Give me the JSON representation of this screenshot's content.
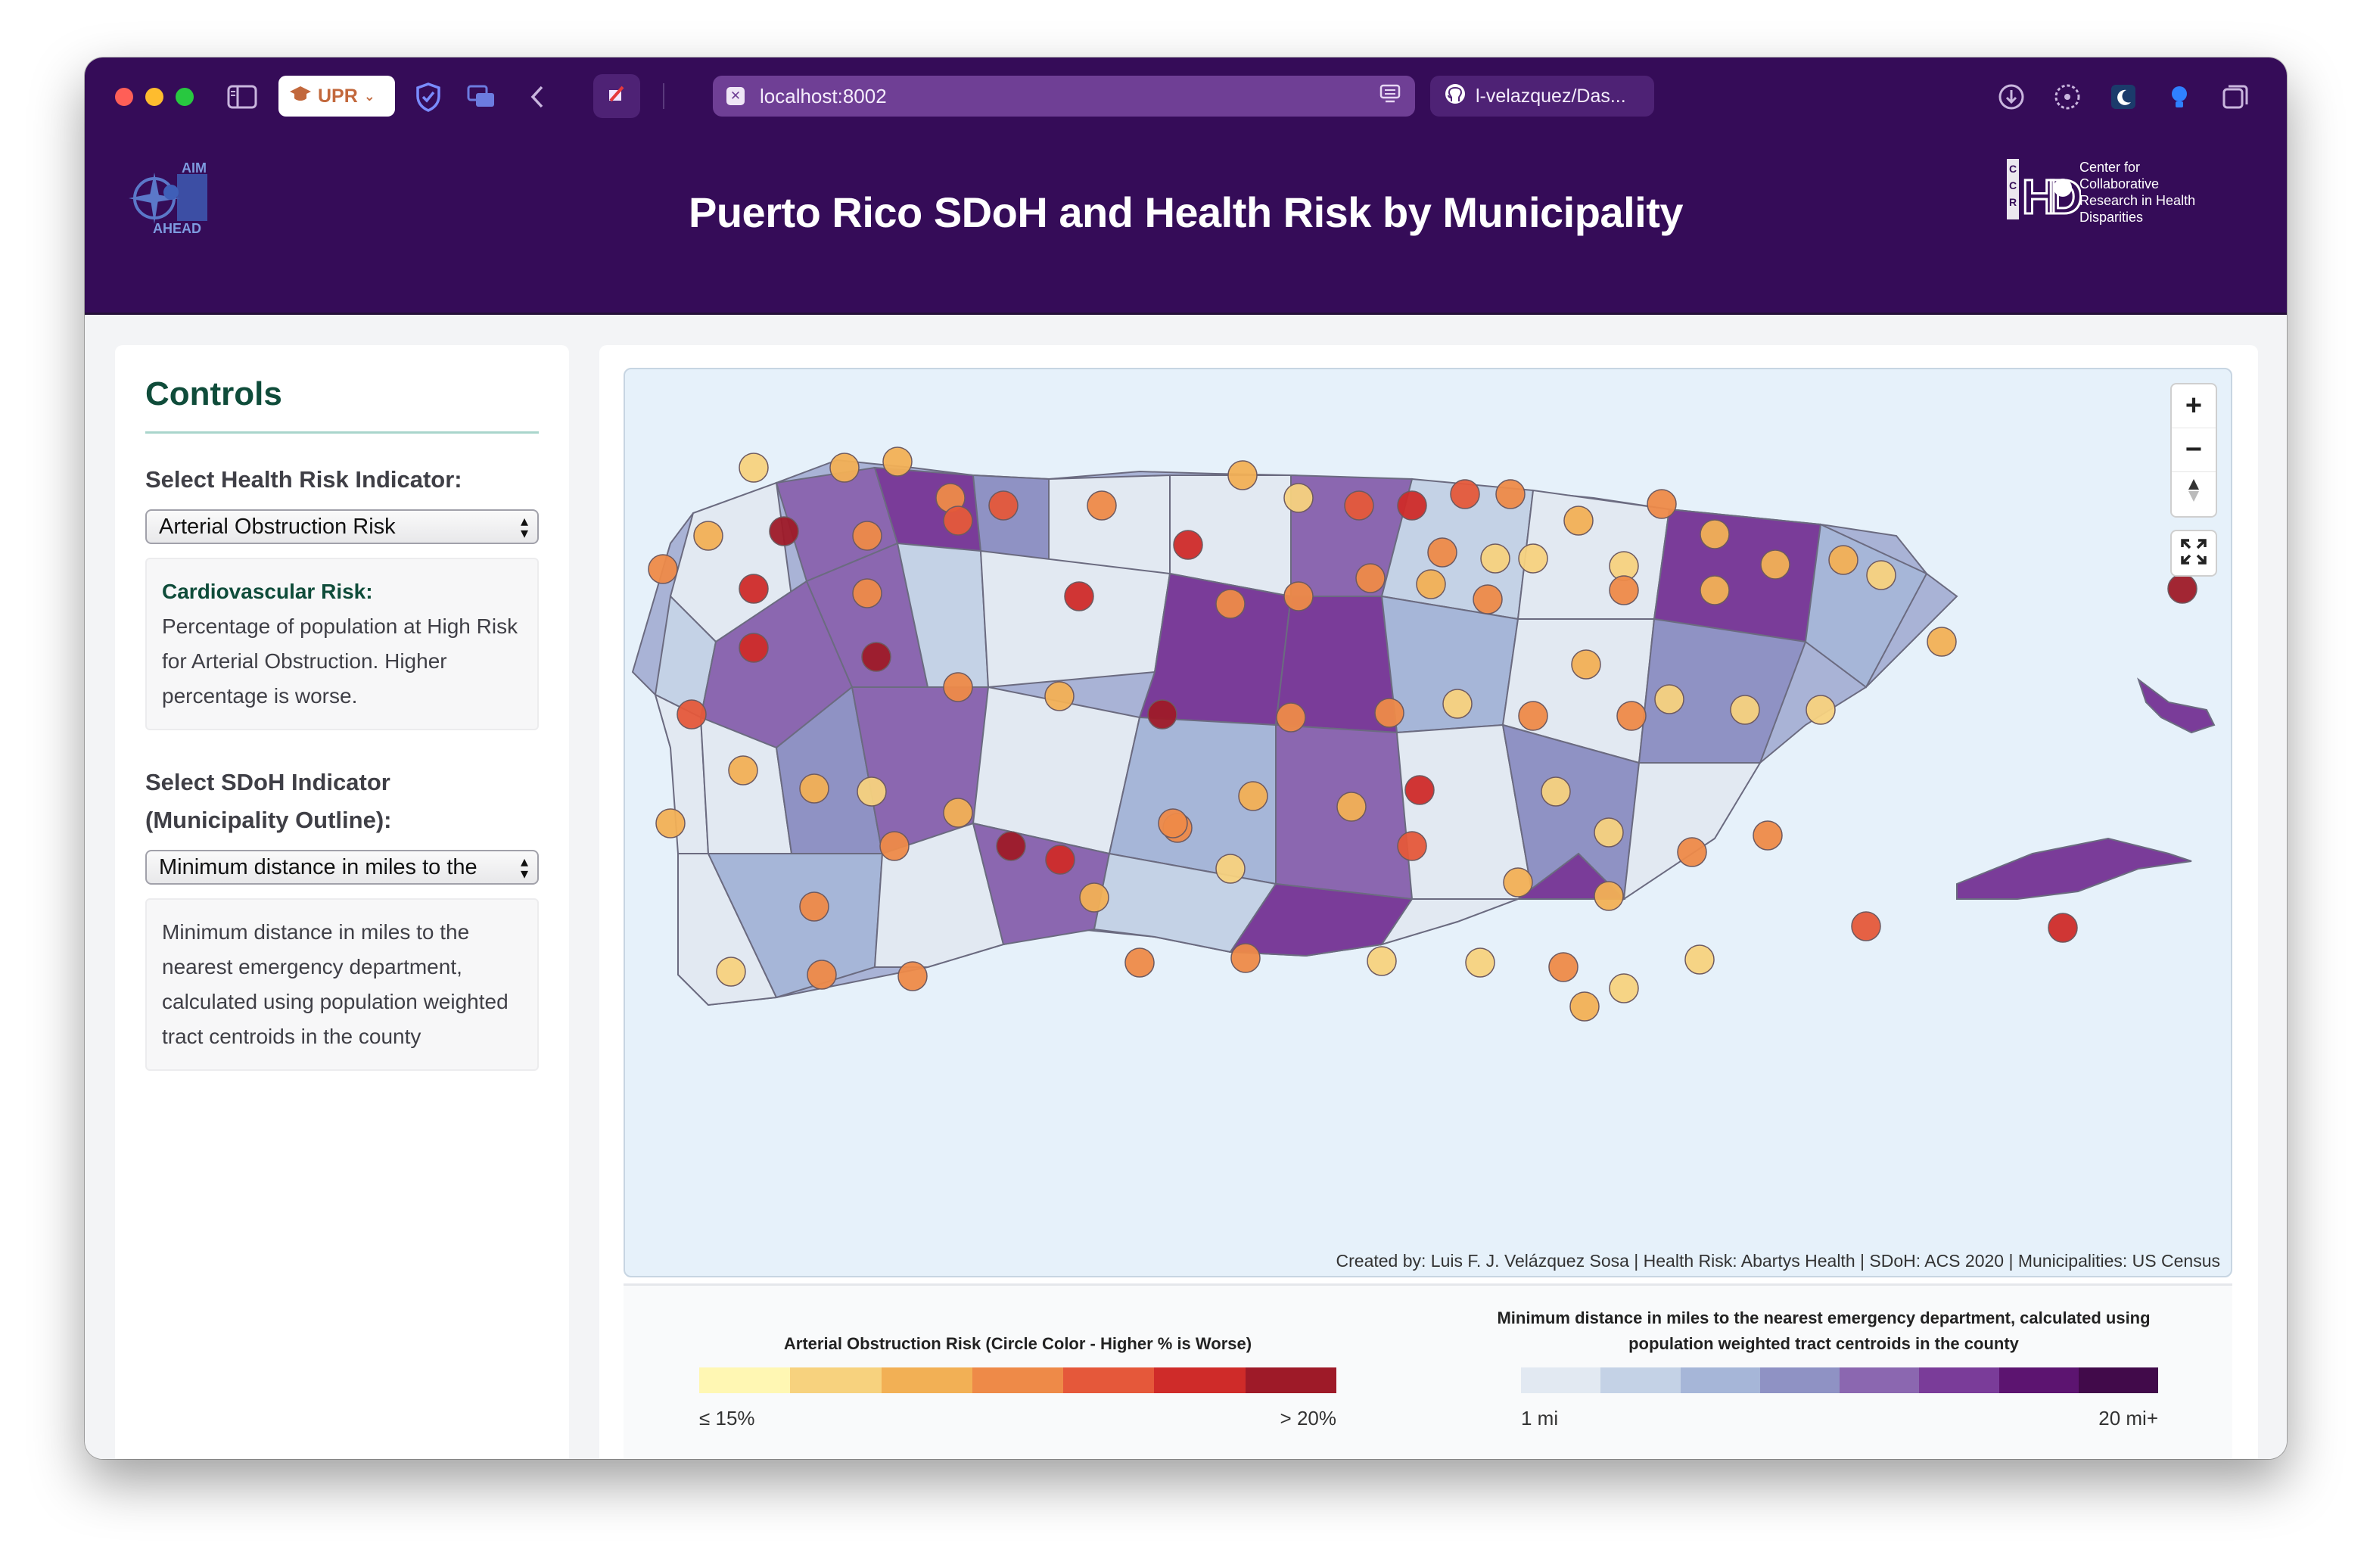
{
  "browser": {
    "profile_label": "UPR",
    "url": "localhost:8002",
    "second_tab_title": "l-velazquez/Das..."
  },
  "header": {
    "title": "Puerto Rico SDoH and Health Risk by Municipality",
    "left_logo_text": [
      "AIM",
      "AHEAD"
    ],
    "right_logo_text": "Center for Collaborative Research in Health Disparities",
    "right_logo_letters": [
      "C",
      "C",
      "R",
      "H",
      "D"
    ]
  },
  "controls": {
    "heading": "Controls",
    "health_label": "Select Health Risk Indicator:",
    "health_selected": "Arterial Obstruction Risk",
    "health_desc_title": "Cardiovascular Risk:",
    "health_desc_body": "Percentage of population at High Risk for Arterial Obstruction. Higher percentage is worse.",
    "sdoh_label": "Select SDoH Indicator (Municipality Outline):",
    "sdoh_selected": "Minimum distance in miles to the",
    "sdoh_desc": "Minimum distance in miles to the nearest emergency department, calculated using population weighted tract centroids in the county"
  },
  "map": {
    "zoom_in": "+",
    "zoom_out": "−",
    "attribution": "Created by: Luis F. J. Velázquez Sosa | Health Risk: Abartys Health | SDoH: ACS 2020 | Municipalities: US Census"
  },
  "legend_health": {
    "title": "Arterial Obstruction Risk (Circle Color - Higher % is Worse)",
    "min_label": "≤ 15%",
    "max_label": "> 20%",
    "colors": [
      "#fff7b3",
      "#f7d27e",
      "#f2b055",
      "#ee8a48",
      "#e5583a",
      "#cf2b29",
      "#9e1a28"
    ]
  },
  "legend_sdoh": {
    "title": "Minimum distance in miles to the nearest emergency department, calculated using population weighted tract centroids in the county",
    "min_label": "1 mi",
    "max_label": "20 mi+",
    "colors": [
      "#e2e9f2",
      "#c4d2e6",
      "#a6b6d8",
      "#8f92c4",
      "#8b67b0",
      "#7a3c99",
      "#5c1470",
      "#410a4a"
    ]
  }
}
